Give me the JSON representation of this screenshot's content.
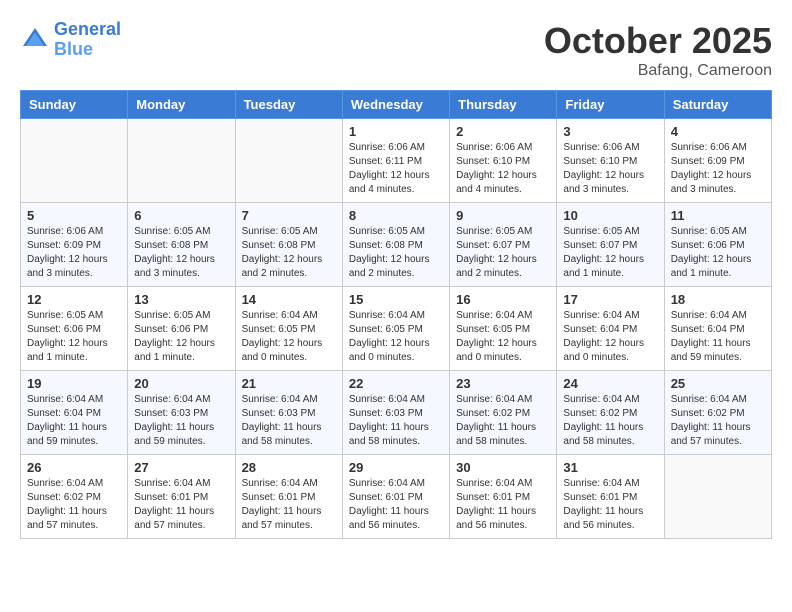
{
  "header": {
    "logo_line1": "General",
    "logo_line2": "Blue",
    "month": "October 2025",
    "location": "Bafang, Cameroon"
  },
  "weekdays": [
    "Sunday",
    "Monday",
    "Tuesday",
    "Wednesday",
    "Thursday",
    "Friday",
    "Saturday"
  ],
  "weeks": [
    [
      {
        "day": "",
        "info": ""
      },
      {
        "day": "",
        "info": ""
      },
      {
        "day": "",
        "info": ""
      },
      {
        "day": "1",
        "info": "Sunrise: 6:06 AM\nSunset: 6:11 PM\nDaylight: 12 hours\nand 4 minutes."
      },
      {
        "day": "2",
        "info": "Sunrise: 6:06 AM\nSunset: 6:10 PM\nDaylight: 12 hours\nand 4 minutes."
      },
      {
        "day": "3",
        "info": "Sunrise: 6:06 AM\nSunset: 6:10 PM\nDaylight: 12 hours\nand 3 minutes."
      },
      {
        "day": "4",
        "info": "Sunrise: 6:06 AM\nSunset: 6:09 PM\nDaylight: 12 hours\nand 3 minutes."
      }
    ],
    [
      {
        "day": "5",
        "info": "Sunrise: 6:06 AM\nSunset: 6:09 PM\nDaylight: 12 hours\nand 3 minutes."
      },
      {
        "day": "6",
        "info": "Sunrise: 6:05 AM\nSunset: 6:08 PM\nDaylight: 12 hours\nand 3 minutes."
      },
      {
        "day": "7",
        "info": "Sunrise: 6:05 AM\nSunset: 6:08 PM\nDaylight: 12 hours\nand 2 minutes."
      },
      {
        "day": "8",
        "info": "Sunrise: 6:05 AM\nSunset: 6:08 PM\nDaylight: 12 hours\nand 2 minutes."
      },
      {
        "day": "9",
        "info": "Sunrise: 6:05 AM\nSunset: 6:07 PM\nDaylight: 12 hours\nand 2 minutes."
      },
      {
        "day": "10",
        "info": "Sunrise: 6:05 AM\nSunset: 6:07 PM\nDaylight: 12 hours\nand 1 minute."
      },
      {
        "day": "11",
        "info": "Sunrise: 6:05 AM\nSunset: 6:06 PM\nDaylight: 12 hours\nand 1 minute."
      }
    ],
    [
      {
        "day": "12",
        "info": "Sunrise: 6:05 AM\nSunset: 6:06 PM\nDaylight: 12 hours\nand 1 minute."
      },
      {
        "day": "13",
        "info": "Sunrise: 6:05 AM\nSunset: 6:06 PM\nDaylight: 12 hours\nand 1 minute."
      },
      {
        "day": "14",
        "info": "Sunrise: 6:04 AM\nSunset: 6:05 PM\nDaylight: 12 hours\nand 0 minutes."
      },
      {
        "day": "15",
        "info": "Sunrise: 6:04 AM\nSunset: 6:05 PM\nDaylight: 12 hours\nand 0 minutes."
      },
      {
        "day": "16",
        "info": "Sunrise: 6:04 AM\nSunset: 6:05 PM\nDaylight: 12 hours\nand 0 minutes."
      },
      {
        "day": "17",
        "info": "Sunrise: 6:04 AM\nSunset: 6:04 PM\nDaylight: 12 hours\nand 0 minutes."
      },
      {
        "day": "18",
        "info": "Sunrise: 6:04 AM\nSunset: 6:04 PM\nDaylight: 11 hours\nand 59 minutes."
      }
    ],
    [
      {
        "day": "19",
        "info": "Sunrise: 6:04 AM\nSunset: 6:04 PM\nDaylight: 11 hours\nand 59 minutes."
      },
      {
        "day": "20",
        "info": "Sunrise: 6:04 AM\nSunset: 6:03 PM\nDaylight: 11 hours\nand 59 minutes."
      },
      {
        "day": "21",
        "info": "Sunrise: 6:04 AM\nSunset: 6:03 PM\nDaylight: 11 hours\nand 58 minutes."
      },
      {
        "day": "22",
        "info": "Sunrise: 6:04 AM\nSunset: 6:03 PM\nDaylight: 11 hours\nand 58 minutes."
      },
      {
        "day": "23",
        "info": "Sunrise: 6:04 AM\nSunset: 6:02 PM\nDaylight: 11 hours\nand 58 minutes."
      },
      {
        "day": "24",
        "info": "Sunrise: 6:04 AM\nSunset: 6:02 PM\nDaylight: 11 hours\nand 58 minutes."
      },
      {
        "day": "25",
        "info": "Sunrise: 6:04 AM\nSunset: 6:02 PM\nDaylight: 11 hours\nand 57 minutes."
      }
    ],
    [
      {
        "day": "26",
        "info": "Sunrise: 6:04 AM\nSunset: 6:02 PM\nDaylight: 11 hours\nand 57 minutes."
      },
      {
        "day": "27",
        "info": "Sunrise: 6:04 AM\nSunset: 6:01 PM\nDaylight: 11 hours\nand 57 minutes."
      },
      {
        "day": "28",
        "info": "Sunrise: 6:04 AM\nSunset: 6:01 PM\nDaylight: 11 hours\nand 57 minutes."
      },
      {
        "day": "29",
        "info": "Sunrise: 6:04 AM\nSunset: 6:01 PM\nDaylight: 11 hours\nand 56 minutes."
      },
      {
        "day": "30",
        "info": "Sunrise: 6:04 AM\nSunset: 6:01 PM\nDaylight: 11 hours\nand 56 minutes."
      },
      {
        "day": "31",
        "info": "Sunrise: 6:04 AM\nSunset: 6:01 PM\nDaylight: 11 hours\nand 56 minutes."
      },
      {
        "day": "",
        "info": ""
      }
    ]
  ]
}
